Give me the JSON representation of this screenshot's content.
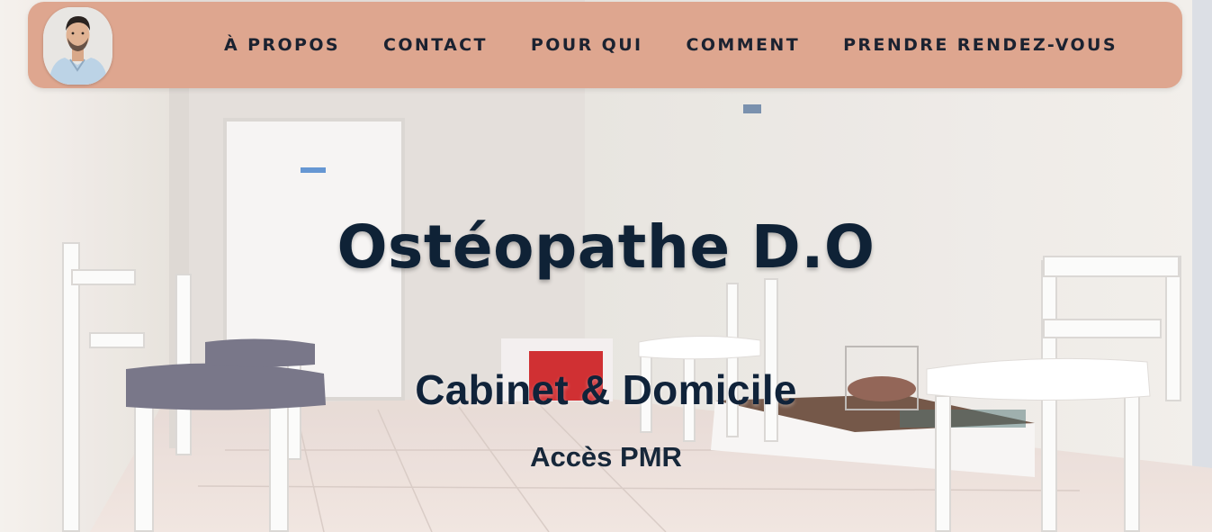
{
  "header": {
    "avatar_icon": "doctor-portrait",
    "nav": [
      {
        "label": "À PROPOS"
      },
      {
        "label": "CONTACT"
      },
      {
        "label": "POUR QUI"
      },
      {
        "label": "COMMENT"
      },
      {
        "label": "PRENDRE RENDEZ-VOUS"
      }
    ]
  },
  "hero": {
    "title": "Ostéopathe D.O",
    "subtitle": "Cabinet & Domicile",
    "note": "Accès PMR"
  },
  "colors": {
    "navbar_bg": "#dea68f",
    "nav_text": "#1b2230",
    "title_text": "#0f2236"
  }
}
